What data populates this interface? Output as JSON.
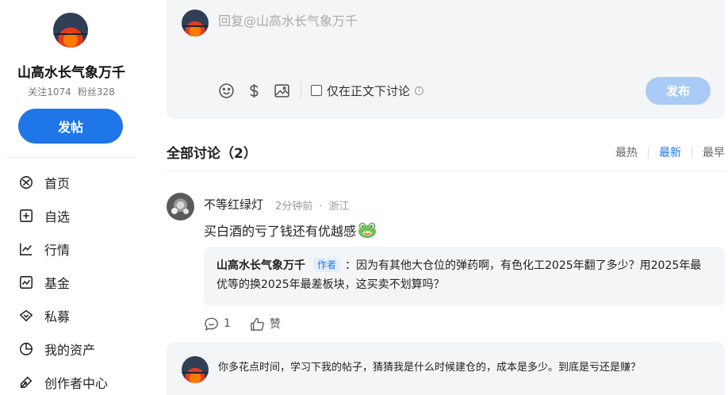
{
  "profile": {
    "name": "山高水长气象万千",
    "following": "关注1074",
    "followers": "粉丝328",
    "post_button": "发帖"
  },
  "nav": [
    {
      "label": "首页",
      "icon": "home-icon"
    },
    {
      "label": "自选",
      "icon": "add-square-icon"
    },
    {
      "label": "行情",
      "icon": "trend-chart-icon"
    },
    {
      "label": "基金",
      "icon": "fund-chart-icon"
    },
    {
      "label": "私募",
      "icon": "diamond-icon"
    },
    {
      "label": "我的资产",
      "icon": "pie-chart-icon"
    },
    {
      "label": "创作者中心",
      "icon": "pen-icon"
    }
  ],
  "reply": {
    "placeholder": "回复@山高水长气象万千",
    "checkbox_label": "仅在正文下讨论",
    "publish": "发布"
  },
  "discussion": {
    "title": "全部讨论（2）",
    "sort": [
      "最热",
      "最新",
      "最早"
    ],
    "active_sort": "最新"
  },
  "comment": {
    "user": "不等红绿灯",
    "time": "2分钟前",
    "location": "浙江",
    "text": "买白酒的亏了钱还有优越感",
    "reply_author": "山高水长气象万千",
    "reply_badge": "作者",
    "reply_text": "：因为有其他大仓位的弹药啊，有色化工2025年翻了多少？用2025年最优等的换2025年最差板块，这买卖不划算吗？",
    "comment_count": "1",
    "like_label": "赞"
  },
  "second_reply": {
    "text": "你多花点时间，学习下我的帖子，猜猜我是什么时候建仓的，成本是多少。到底是亏还是赚？"
  },
  "colors": {
    "accent": "#1e76e8",
    "publish_disabled": "#a9cbf5",
    "panel_bg": "#f4f5f7"
  }
}
